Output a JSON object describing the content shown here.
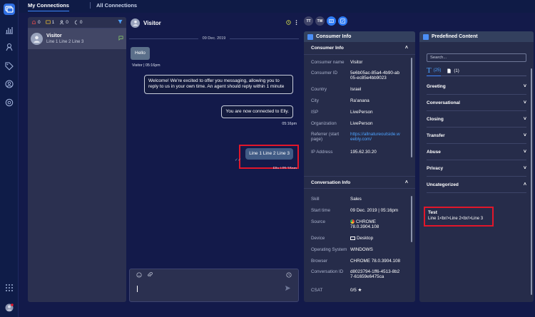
{
  "tabs": {
    "my_connections": "My Connections",
    "all_connections": "All Connections"
  },
  "counters": {
    "alerts": "0",
    "pending": "1",
    "assigned": "0",
    "waiting": "0"
  },
  "conversation_item": {
    "name": "Visitor",
    "preview": "Line 1 Line 2 Line 3"
  },
  "chat": {
    "title": "Visitor",
    "date": "09 Dec. 2019",
    "messages": [
      {
        "text": "Hello",
        "meta": "Visitor | 05:16pm"
      },
      {
        "text": "Welcome! We're excited to offer you messaging, allowing you to reply to us in your own time. An agent should reply within 1 minute"
      },
      {
        "text": "You are now connected to Elly.",
        "meta": "05:16pm"
      },
      {
        "text": "Line 1 Line 2 Line 3",
        "meta": "Elly | 05:16pm"
      }
    ]
  },
  "tool_buttons": {
    "tt": "TT",
    "tw": "TW"
  },
  "consumer_panel": {
    "title": "Consumer Info",
    "section_consumer": "Consumer Info",
    "consumer_rows": [
      {
        "k": "Consumer name",
        "v": "Visitor"
      },
      {
        "k": "Consumer ID",
        "v": "5e6b05ac-85a4-4b90-ab05-ec85e4bb9023"
      },
      {
        "k": "Country",
        "v": "Israel"
      },
      {
        "k": "City",
        "v": "Ra'anana"
      },
      {
        "k": "ISP",
        "v": "LivePerson"
      },
      {
        "k": "Organization",
        "v": "LivePerson"
      },
      {
        "k": "Referrer (start page)",
        "v": "https://allnatureoutside.weebly.com/"
      },
      {
        "k": "IP Address",
        "v": "195.62.30.20"
      }
    ],
    "section_conversation": "Conversation Info",
    "conversation_rows": [
      {
        "k": "Skill",
        "v": "Sales"
      },
      {
        "k": "Start time",
        "v": "09 Dec. 2019 | 05:16pm"
      },
      {
        "k": "Source",
        "v": "CHROME 78.0.3904.108"
      },
      {
        "k": "Device",
        "v": "Desktop"
      },
      {
        "k": "Operating System",
        "v": "WINDOWS"
      },
      {
        "k": "Browser",
        "v": "CHROME 78.0.3904.108"
      },
      {
        "k": "Conversation ID",
        "v": "d8023794-1ff6-4513-8b27-61659e6475ca"
      },
      {
        "k": "CSAT",
        "v": "0/5 ★"
      }
    ]
  },
  "predefined": {
    "title": "Predefined Content",
    "search_placeholder": "Search...",
    "tab_text_count": "(25)",
    "tab_files_count": "(1)",
    "categories": [
      "Greeting",
      "Conversational",
      "Closing",
      "Transfer",
      "Abuse",
      "Privacy",
      "Uncategorized"
    ],
    "item": {
      "title": "Test",
      "content": "Line 1<br/>Line 2<br/>Line 3"
    }
  },
  "colors": {
    "accent": "#2e7cf6",
    "highlight": "#e2162a",
    "background": "#131a4a"
  }
}
